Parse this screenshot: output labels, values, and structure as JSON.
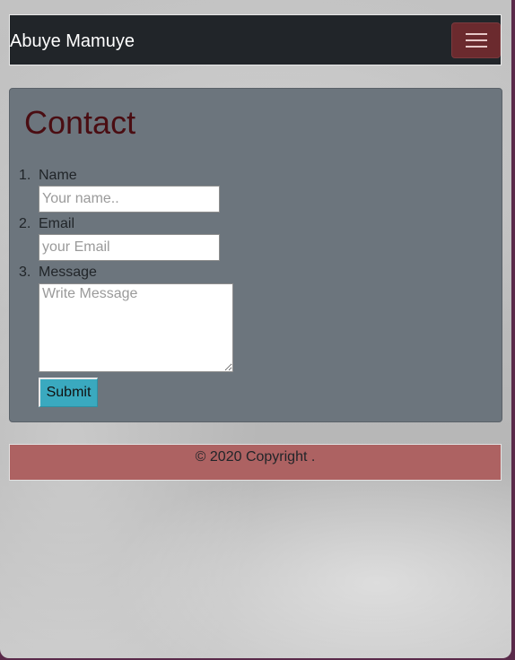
{
  "navbar": {
    "brand": "Abuye Mamuye",
    "toggler_icon": "hamburger-menu-icon"
  },
  "contact": {
    "title": "Contact",
    "items": [
      {
        "number": "1.",
        "label": "Name",
        "placeholder": "Your name.."
      },
      {
        "number": "2.",
        "label": "Email",
        "placeholder": "your Email"
      },
      {
        "number": "3.",
        "label": "Message",
        "placeholder": "Write Message"
      }
    ],
    "submit_label": "Submit"
  },
  "footer": {
    "text": "© 2020 Copyright ."
  },
  "colors": {
    "navbar_bg": "#212529",
    "toggler_bg": "#6b2a2e",
    "card_bg": "#6c757d",
    "title_color": "#4a0d12",
    "submit_bg": "#3aa9bf",
    "footer_bg": "#ad6262"
  }
}
